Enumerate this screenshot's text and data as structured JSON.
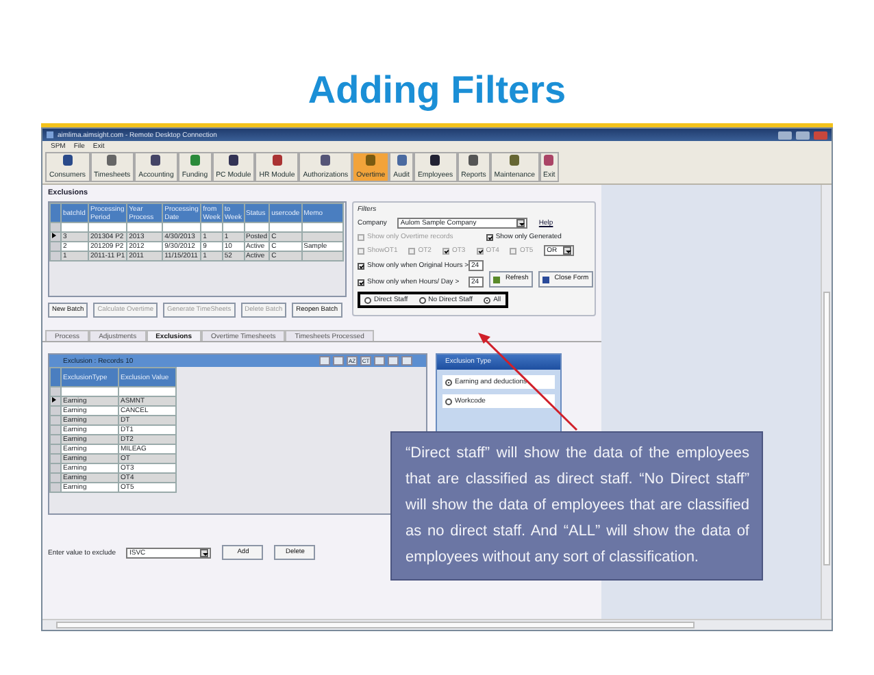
{
  "slide": {
    "title": "Adding Filters"
  },
  "window": {
    "title": "aimlima.aimsight.com - Remote Desktop Connection",
    "menu": [
      "SPM",
      "File",
      "Exit"
    ]
  },
  "toolbar": [
    {
      "label": "Consumers",
      "selected": false
    },
    {
      "label": "Timesheets",
      "selected": false
    },
    {
      "label": "Accounting",
      "selected": false
    },
    {
      "label": "Funding",
      "selected": false
    },
    {
      "label": "PC Module",
      "selected": false
    },
    {
      "label": "HR Module",
      "selected": false
    },
    {
      "label": "Authorizations",
      "selected": false
    },
    {
      "label": "Overtime",
      "selected": true
    },
    {
      "label": "Audit",
      "selected": false
    },
    {
      "label": "Employees",
      "selected": false
    },
    {
      "label": "Reports",
      "selected": false
    },
    {
      "label": "Maintenance",
      "selected": false
    },
    {
      "label": "Exit",
      "selected": false
    }
  ],
  "batches": {
    "title": "Exclusions",
    "columns": [
      "batchId",
      "Processing Period",
      "Year Process",
      "Processing Date",
      "from Week",
      "to Week",
      "Status",
      "usercode",
      "Memo"
    ],
    "rows": [
      {
        "selected": true,
        "cells": [
          "3",
          "201304 P2",
          "2013",
          "4/30/2013",
          "1",
          "1",
          "Posted",
          "C",
          ""
        ]
      },
      {
        "selected": false,
        "cells": [
          "2",
          "201209 P2",
          "2012",
          "9/30/2012",
          "9",
          "10",
          "Active",
          "C",
          "Sample"
        ]
      },
      {
        "selected": false,
        "cells": [
          "1",
          "2011-11 P1",
          "2011",
          "11/15/2011",
          "1",
          "52",
          "Active",
          "C",
          ""
        ]
      }
    ],
    "buttons": [
      {
        "label": "New Batch",
        "disabled": false
      },
      {
        "label": "Calculate Overtime",
        "disabled": true
      },
      {
        "label": "Generate TimeSheets",
        "disabled": true
      },
      {
        "label": "Delete Batch",
        "disabled": true
      },
      {
        "label": "Reopen Batch",
        "disabled": false
      }
    ]
  },
  "filters": {
    "title": "Filters",
    "company_label": "Company",
    "company": "Aulom Sample Company",
    "help": "Help",
    "checks": [
      {
        "label": "Show only Overtime records",
        "checked": false,
        "disabled": true
      },
      {
        "label": "Show only Generated",
        "checked": true,
        "disabled": false
      }
    ],
    "ot_checks": [
      {
        "label": "ShowOT1",
        "checked": false
      },
      {
        "label": "OT2",
        "checked": false
      },
      {
        "label": "OT3",
        "checked": true
      },
      {
        "label": "OT4",
        "checked": true
      },
      {
        "label": "OT5",
        "checked": false
      }
    ],
    "operator": "OR",
    "hour_filters": [
      {
        "label": "Show only when Original Hours >",
        "checked": true,
        "value": "24"
      },
      {
        "label": "Show only when Hours/ Day >",
        "checked": true,
        "value": "24"
      }
    ],
    "buttons": [
      "Refresh",
      "Close Form"
    ],
    "staff_options": [
      {
        "label": "Direct Staff",
        "selected": false
      },
      {
        "label": "No Direct Staff",
        "selected": false
      },
      {
        "label": "All",
        "selected": true
      }
    ]
  },
  "tabs": [
    {
      "label": "Process",
      "selected": false
    },
    {
      "label": "Adjustments",
      "selected": false
    },
    {
      "label": "Exclusions",
      "selected": true
    },
    {
      "label": "Overtime Timesheets",
      "selected": false
    },
    {
      "label": "Timesheets Processed",
      "selected": false
    }
  ],
  "exclusions": {
    "title": "Exclusion : Records 10",
    "sort_label": "AZ",
    "filter_label": "CT",
    "columns": [
      "ExclusionType",
      "Exclusion Value"
    ],
    "rows": [
      {
        "selected": true,
        "cells": [
          "Earning",
          "ASMNT"
        ]
      },
      {
        "selected": false,
        "cells": [
          "Earning",
          "CANCEL"
        ]
      },
      {
        "selected": false,
        "cells": [
          "Earning",
          "DT"
        ]
      },
      {
        "selected": false,
        "cells": [
          "Earning",
          "DT1"
        ]
      },
      {
        "selected": false,
        "cells": [
          "Earning",
          "DT2"
        ]
      },
      {
        "selected": false,
        "cells": [
          "Earning",
          "MILEAG"
        ]
      },
      {
        "selected": false,
        "cells": [
          "Earning",
          "OT"
        ]
      },
      {
        "selected": false,
        "cells": [
          "Earning",
          "OT3"
        ]
      },
      {
        "selected": false,
        "cells": [
          "Earning",
          "OT4"
        ]
      },
      {
        "selected": false,
        "cells": [
          "Earning",
          "OT5"
        ]
      }
    ]
  },
  "exclusion_type": {
    "title": "Exclusion Type",
    "options": [
      {
        "label": "Earning and deductions",
        "selected": true
      },
      {
        "label": "Workcode",
        "selected": false
      }
    ]
  },
  "entry": {
    "label": "Enter value to exclude",
    "value": "ISVC",
    "buttons": [
      "Add",
      "Delete"
    ]
  },
  "callout": {
    "text": "“Direct staff” will show the data of the employees that are classified as direct staff. “No Direct staff” will show the data of employees that are classified as no direct staff. And “ALL” will show the data of employees without any sort of classification."
  }
}
